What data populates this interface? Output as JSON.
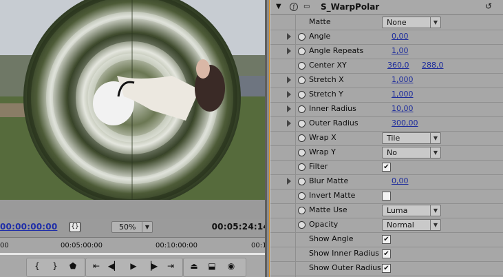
{
  "monitor": {
    "current_time": "00:00:00:00",
    "duration": "00:05:24:14",
    "zoom": "50%",
    "ruler_labels": [
      "00",
      "00:05:00:00",
      "00:10:00:00",
      "00:1"
    ]
  },
  "controls_icons": [
    "mark-in-icon",
    "mark-out-icon",
    "marker-icon",
    "goto-in-icon",
    "step-back-icon",
    "play-icon",
    "step-forward-icon",
    "goto-out-icon",
    "lift-icon",
    "extract-icon",
    "output-icon"
  ],
  "effect": {
    "name": "S_WarpPolar",
    "rows": [
      {
        "label": "Matte",
        "type": "dropdown",
        "value": "None",
        "twirl": false,
        "stopwatch": false
      },
      {
        "label": "Angle",
        "type": "value",
        "value": "0,00",
        "twirl": true,
        "stopwatch": true
      },
      {
        "label": "Angle Repeats",
        "type": "value",
        "value": "1,00",
        "twirl": true,
        "stopwatch": true
      },
      {
        "label": "Center XY",
        "type": "xy",
        "value": "360,0",
        "value2": "288,0",
        "twirl": false,
        "stopwatch": true
      },
      {
        "label": "Stretch X",
        "type": "value",
        "value": "1,000",
        "twirl": true,
        "stopwatch": true
      },
      {
        "label": "Stretch Y",
        "type": "value",
        "value": "1,000",
        "twirl": true,
        "stopwatch": true
      },
      {
        "label": "Inner Radius",
        "type": "value",
        "value": "10,00",
        "twirl": true,
        "stopwatch": true
      },
      {
        "label": "Outer Radius",
        "type": "value",
        "value": "300,00",
        "twirl": true,
        "stopwatch": true
      },
      {
        "label": "Wrap X",
        "type": "dropdown",
        "value": "Tile",
        "twirl": false,
        "stopwatch": true
      },
      {
        "label": "Wrap Y",
        "type": "dropdown",
        "value": "No",
        "twirl": false,
        "stopwatch": true
      },
      {
        "label": "Filter",
        "type": "checkbox",
        "value": "✔",
        "twirl": false,
        "stopwatch": true
      },
      {
        "label": "Blur Matte",
        "type": "value",
        "value": "0,00",
        "twirl": true,
        "stopwatch": true
      },
      {
        "label": "Invert Matte",
        "type": "checkbox",
        "value": "",
        "twirl": false,
        "stopwatch": true
      },
      {
        "label": "Matte Use",
        "type": "dropdown",
        "value": "Luma",
        "twirl": false,
        "stopwatch": true
      },
      {
        "label": "Opacity",
        "type": "dropdown",
        "value": "Normal",
        "twirl": false,
        "stopwatch": true
      },
      {
        "label": "Show Angle",
        "type": "checkbox",
        "value": "✔",
        "twirl": false,
        "stopwatch": false
      },
      {
        "label": "Show Inner Radius",
        "type": "checkbox",
        "value": "✔",
        "twirl": false,
        "stopwatch": false
      },
      {
        "label": "Show Outer Radius",
        "type": "checkbox",
        "value": "✔",
        "twirl": false,
        "stopwatch": false
      }
    ]
  }
}
